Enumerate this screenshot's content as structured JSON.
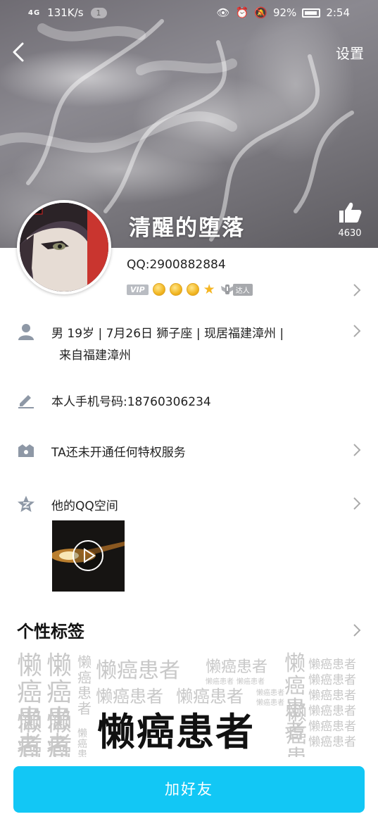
{
  "status_bar": {
    "network": "4G",
    "speed": "131K/s",
    "notification_count": "1",
    "battery": "92%",
    "time": "2:54"
  },
  "header": {
    "settings_label": "设置",
    "nickname": "清醒的堕落",
    "like_count": "4630"
  },
  "profile": {
    "qq_number": "QQ:2900882884",
    "vip_label": "VIP",
    "daren_label": "达人"
  },
  "info_rows": {
    "basic_line1": "男  19岁  |  7月26日  狮子座  |  现居福建漳州  |",
    "basic_line2": "来自福建漳州",
    "signature": "本人手机号码:18760306234",
    "privilege": "TA还未开通任何特权服务",
    "qzone": "他的QQ空间"
  },
  "tags": {
    "title": "个性标签",
    "main_tag": "懒癌患者",
    "background_word": "懒癌患者"
  },
  "actions": {
    "add_friend": "加好友"
  }
}
